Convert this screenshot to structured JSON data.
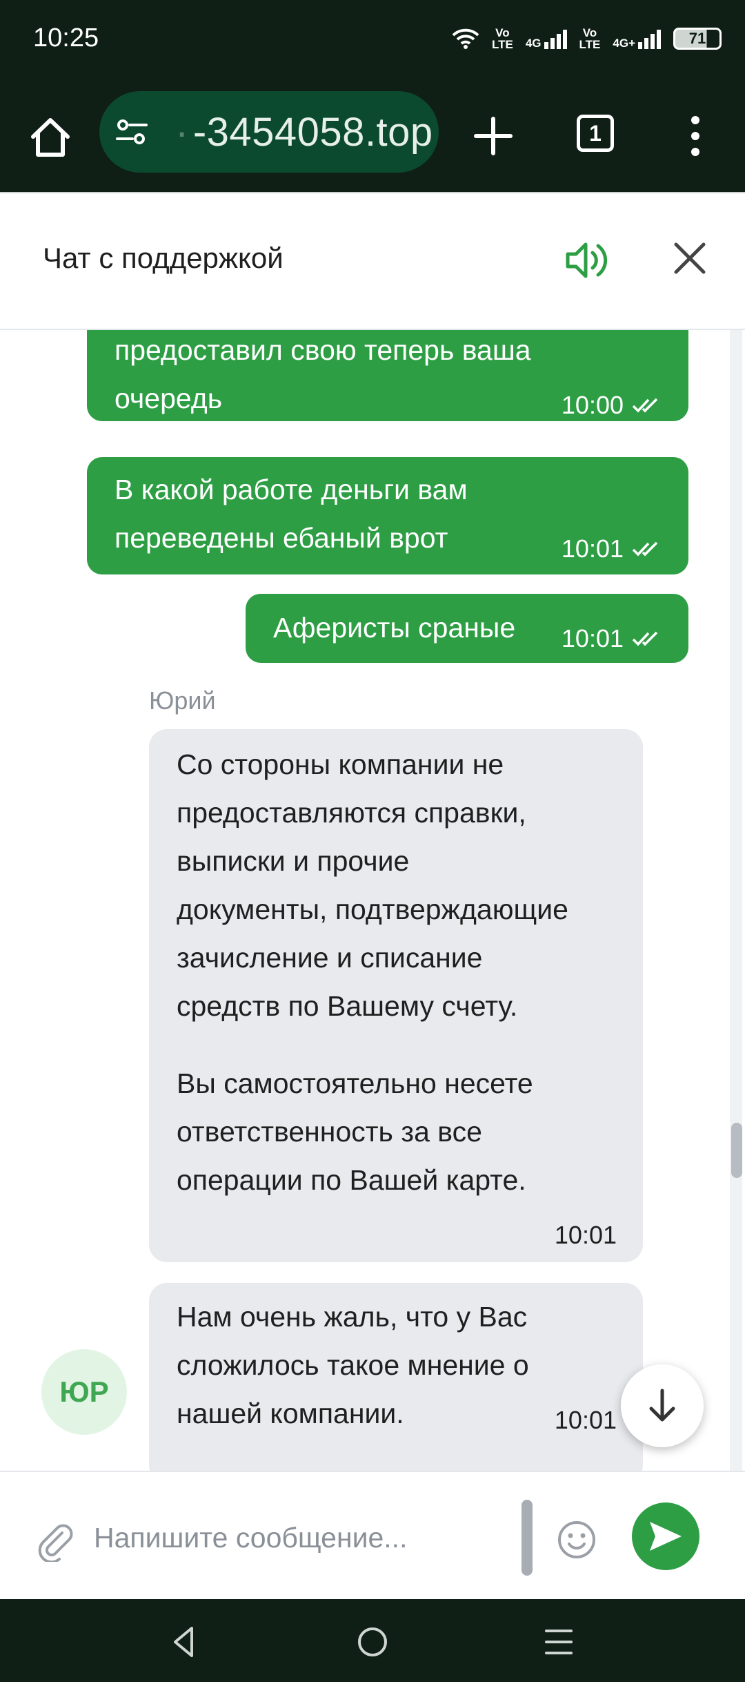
{
  "status_bar": {
    "time": "10:25",
    "network_1": [
      "Vo",
      "LTE"
    ],
    "network_2": [
      "4G"
    ],
    "network_3": [
      "Vo",
      "LTE"
    ],
    "network_4": [
      "4G+"
    ],
    "battery": "71"
  },
  "browser": {
    "url": "-3454058.top",
    "tab_count": "1"
  },
  "chat_header": {
    "title": "Чат с поддержкой"
  },
  "messages": {
    "out_1": {
      "line1": "предоставил свою теперь ваша",
      "line2": "очередь",
      "time": "10:00"
    },
    "out_2": {
      "line1": "В какой работе деньги вам",
      "line2": "переведены ебаный врот",
      "time": "10:01"
    },
    "out_3": {
      "text": "Аферисты сраные",
      "time": "10:01"
    },
    "sender": "Юрий",
    "in_1": {
      "para1": [
        "Со стороны компании не",
        "предоставляются справки,",
        "выписки и прочие",
        "документы, подтверждающие",
        "зачисление и списание",
        "средств по Вашему счету."
      ],
      "para2": [
        "Вы самостоятельно несете",
        "ответственность за все",
        "операции по Вашей карте."
      ],
      "time": "10:01"
    },
    "in_2": {
      "lines": [
        "Нам очень жаль, что у Вас",
        "сложилось такое мнение о",
        "нашей компании."
      ],
      "time": "10:01"
    }
  },
  "avatar": {
    "initials": "ЮР"
  },
  "composer": {
    "placeholder": "Напишите сообщение..."
  },
  "colors": {
    "outgoing_bubble": "#2e9e45",
    "incoming_bubble": "#e8eaed",
    "system_bar": "#0f1f16",
    "accent": "#2e9e45"
  },
  "icons": {
    "home": "home-icon",
    "tune": "tune-icon",
    "add_tab": "plus-icon",
    "menu": "more-vert-icon",
    "sound": "volume-icon",
    "close": "close-icon",
    "read": "double-check-icon",
    "scroll_down": "arrow-down-icon",
    "attach": "paperclip-icon",
    "emoji": "smiley-icon",
    "send": "send-icon"
  }
}
